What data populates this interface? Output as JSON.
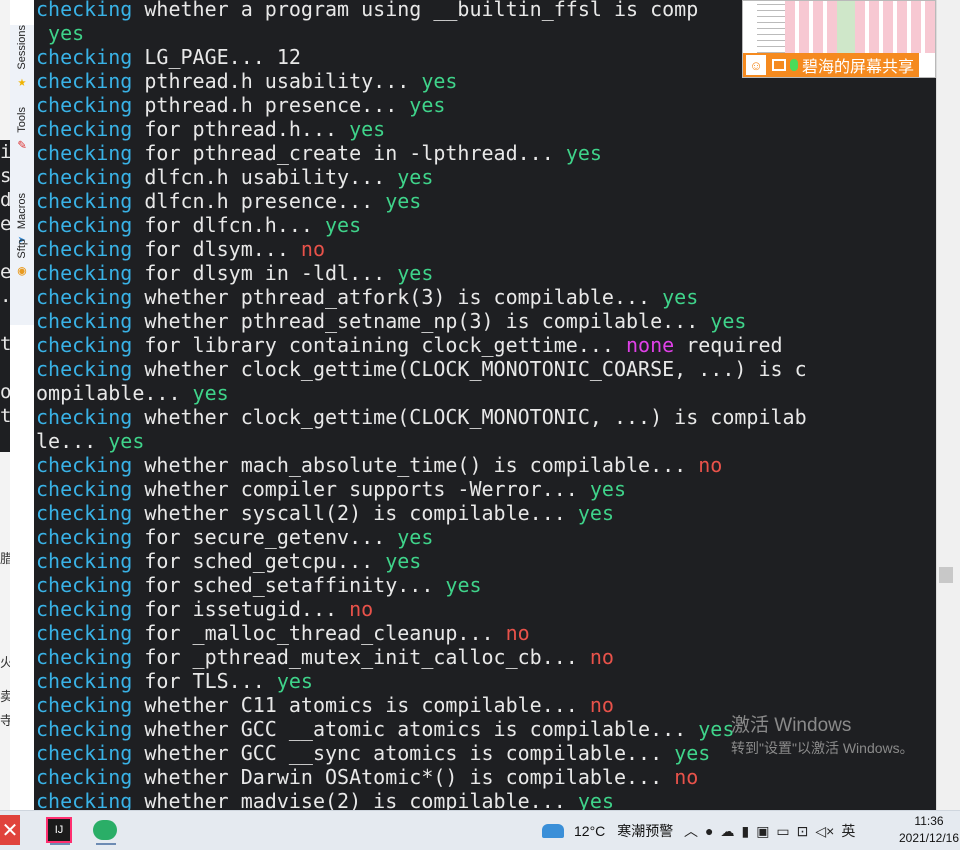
{
  "side_tabs": [
    {
      "label": "Sessions",
      "icon": "star-icon"
    },
    {
      "label": "Tools",
      "icon": "wrench-icon"
    },
    {
      "label": "Macros",
      "icon": "paper-plane-icon"
    },
    {
      "label": "Sftp",
      "icon": "globe-icon"
    }
  ],
  "behind_window": {
    "chars": [
      "i",
      "s",
      "d",
      "e",
      "",
      "e",
      ".",
      "",
      "t",
      "",
      "o",
      "t"
    ],
    "cjk": [
      "腊",
      "火",
      "卖",
      "寺"
    ]
  },
  "terminal": {
    "lines": [
      [
        {
          "t": "checking",
          "c": "kw"
        },
        {
          "t": " whether a program using __builtin_ffsl is comp"
        }
      ],
      [
        {
          "t": " yes",
          "c": "ok"
        }
      ],
      [
        {
          "t": "checking",
          "c": "kw"
        },
        {
          "t": " LG_PAGE... 12"
        }
      ],
      [
        {
          "t": "checking",
          "c": "kw"
        },
        {
          "t": " pthread.h usability... "
        },
        {
          "t": "yes",
          "c": "ok"
        }
      ],
      [
        {
          "t": "checking",
          "c": "kw"
        },
        {
          "t": " pthread.h presence... "
        },
        {
          "t": "yes",
          "c": "ok"
        }
      ],
      [
        {
          "t": "checking",
          "c": "kw"
        },
        {
          "t": " for pthread.h... "
        },
        {
          "t": "yes",
          "c": "ok"
        }
      ],
      [
        {
          "t": "checking",
          "c": "kw"
        },
        {
          "t": " for pthread_create in -lpthread... "
        },
        {
          "t": "yes",
          "c": "ok"
        }
      ],
      [
        {
          "t": "checking",
          "c": "kw"
        },
        {
          "t": " dlfcn.h usability... "
        },
        {
          "t": "yes",
          "c": "ok"
        }
      ],
      [
        {
          "t": "checking",
          "c": "kw"
        },
        {
          "t": " dlfcn.h presence... "
        },
        {
          "t": "yes",
          "c": "ok"
        }
      ],
      [
        {
          "t": "checking",
          "c": "kw"
        },
        {
          "t": " for dlfcn.h... "
        },
        {
          "t": "yes",
          "c": "ok"
        }
      ],
      [
        {
          "t": "checking",
          "c": "kw"
        },
        {
          "t": " for dlsym... "
        },
        {
          "t": "no",
          "c": "bad"
        }
      ],
      [
        {
          "t": "checking",
          "c": "kw"
        },
        {
          "t": " for dlsym in -ldl... "
        },
        {
          "t": "yes",
          "c": "ok"
        }
      ],
      [
        {
          "t": "checking",
          "c": "kw"
        },
        {
          "t": " whether pthread_atfork(3) is compilable... "
        },
        {
          "t": "yes",
          "c": "ok"
        }
      ],
      [
        {
          "t": "checking",
          "c": "kw"
        },
        {
          "t": " whether pthread_setname_np(3) is compilable... "
        },
        {
          "t": "yes",
          "c": "ok"
        }
      ],
      [
        {
          "t": "checking",
          "c": "kw"
        },
        {
          "t": " for library containing clock_gettime... "
        },
        {
          "t": "none",
          "c": "mag"
        },
        {
          "t": " required"
        }
      ],
      [
        {
          "t": "checking",
          "c": "kw"
        },
        {
          "t": " whether clock_gettime(CLOCK_MONOTONIC_COARSE, ...) is c"
        }
      ],
      [
        {
          "t": "ompilable... "
        },
        {
          "t": "yes",
          "c": "ok"
        }
      ],
      [
        {
          "t": "checking",
          "c": "kw"
        },
        {
          "t": " whether clock_gettime(CLOCK_MONOTONIC, ...) is compilab"
        }
      ],
      [
        {
          "t": "le... "
        },
        {
          "t": "yes",
          "c": "ok"
        }
      ],
      [
        {
          "t": "checking",
          "c": "kw"
        },
        {
          "t": " whether mach_absolute_time() is compilable... "
        },
        {
          "t": "no",
          "c": "bad"
        }
      ],
      [
        {
          "t": "checking",
          "c": "kw"
        },
        {
          "t": " whether compiler supports -Werror... "
        },
        {
          "t": "yes",
          "c": "ok"
        }
      ],
      [
        {
          "t": "checking",
          "c": "kw"
        },
        {
          "t": " whether syscall(2) is compilable... "
        },
        {
          "t": "yes",
          "c": "ok"
        }
      ],
      [
        {
          "t": "checking",
          "c": "kw"
        },
        {
          "t": " for secure_getenv... "
        },
        {
          "t": "yes",
          "c": "ok"
        }
      ],
      [
        {
          "t": "checking",
          "c": "kw"
        },
        {
          "t": " for sched_getcpu... "
        },
        {
          "t": "yes",
          "c": "ok"
        }
      ],
      [
        {
          "t": "checking",
          "c": "kw"
        },
        {
          "t": " for sched_setaffinity... "
        },
        {
          "t": "yes",
          "c": "ok"
        }
      ],
      [
        {
          "t": "checking",
          "c": "kw"
        },
        {
          "t": " for issetugid... "
        },
        {
          "t": "no",
          "c": "bad"
        }
      ],
      [
        {
          "t": "checking",
          "c": "kw"
        },
        {
          "t": " for _malloc_thread_cleanup... "
        },
        {
          "t": "no",
          "c": "bad"
        }
      ],
      [
        {
          "t": "checking",
          "c": "kw"
        },
        {
          "t": " for _pthread_mutex_init_calloc_cb... "
        },
        {
          "t": "no",
          "c": "bad"
        }
      ],
      [
        {
          "t": "checking",
          "c": "kw"
        },
        {
          "t": " for TLS... "
        },
        {
          "t": "yes",
          "c": "ok"
        }
      ],
      [
        {
          "t": "checking",
          "c": "kw"
        },
        {
          "t": " whether C11 atomics is compilable... "
        },
        {
          "t": "no",
          "c": "bad"
        }
      ],
      [
        {
          "t": "checking",
          "c": "kw"
        },
        {
          "t": " whether GCC __atomic atomics is compilable... "
        },
        {
          "t": "yes",
          "c": "ok"
        }
      ],
      [
        {
          "t": "checking",
          "c": "kw"
        },
        {
          "t": " whether GCC __sync atomics is compilable... "
        },
        {
          "t": "yes",
          "c": "ok"
        }
      ],
      [
        {
          "t": "checking",
          "c": "kw"
        },
        {
          "t": " whether Darwin OSAtomic*() is compilable... "
        },
        {
          "t": "no",
          "c": "bad"
        }
      ],
      [
        {
          "t": "checking",
          "c": "kw"
        },
        {
          "t": " whether madvise(2) is compilable... "
        },
        {
          "t": "yes",
          "c": "ok"
        }
      ]
    ]
  },
  "screen_share": {
    "label": "碧海的屏幕共享"
  },
  "activation": {
    "title": "激活 Windows",
    "subtitle": "转到\"设置\"以激活 Windows。"
  },
  "taskbar": {
    "weather": {
      "temp": "12°C",
      "alert": "寒潮预警"
    },
    "tray_icons": [
      "chevron-up-icon",
      "qq-icon",
      "cloud-icon",
      "mic-icon",
      "sim-icon",
      "monitor-icon",
      "display-icon",
      "speaker-muted-icon"
    ],
    "ime": "英",
    "time": "11:36",
    "date": "2021/12/16"
  },
  "colors": {
    "terminal_bg": "#1e1f22",
    "keyword": "#39b2e6",
    "yes": "#3fd38a",
    "no": "#e8524a",
    "none": "#e040e8",
    "share_bar": "#f58a1f"
  }
}
